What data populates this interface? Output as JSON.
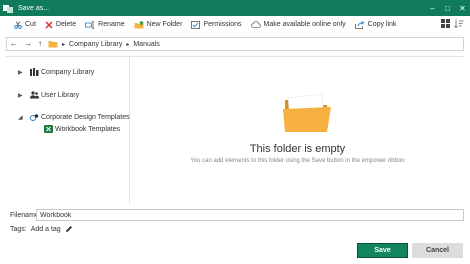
{
  "window": {
    "title": "Save as...",
    "minimize_icon": "minimize-icon",
    "maximize_icon": "maximize-icon",
    "close_icon": "close-icon"
  },
  "toolbar": {
    "cut": "Cut",
    "delete": "Delete",
    "rename": "Rename",
    "new_folder": "New Folder",
    "permissions": "Permissions",
    "available_online": "Make available online only",
    "copy_link": "Copy link"
  },
  "breadcrumb": [
    "Company Library",
    "Manuals"
  ],
  "tree": {
    "company_library": "Company Library",
    "user_library": "User Library",
    "corporate_templates": "Corporate Design Templates",
    "workbook_templates": "Workbook Templates"
  },
  "empty_state": {
    "title": "This folder is empty",
    "subtitle": "You can add elements to this folder using the Save button in the empower ribbon"
  },
  "filename": {
    "label": "Filename",
    "value": "Workbook"
  },
  "tags": {
    "label": "Tags:",
    "add": "Add a tag"
  },
  "buttons": {
    "save": "Save",
    "cancel": "Cancel"
  },
  "colors": {
    "accent": "#0f7b5b",
    "save": "#14865f",
    "folder": "#f5b041"
  }
}
